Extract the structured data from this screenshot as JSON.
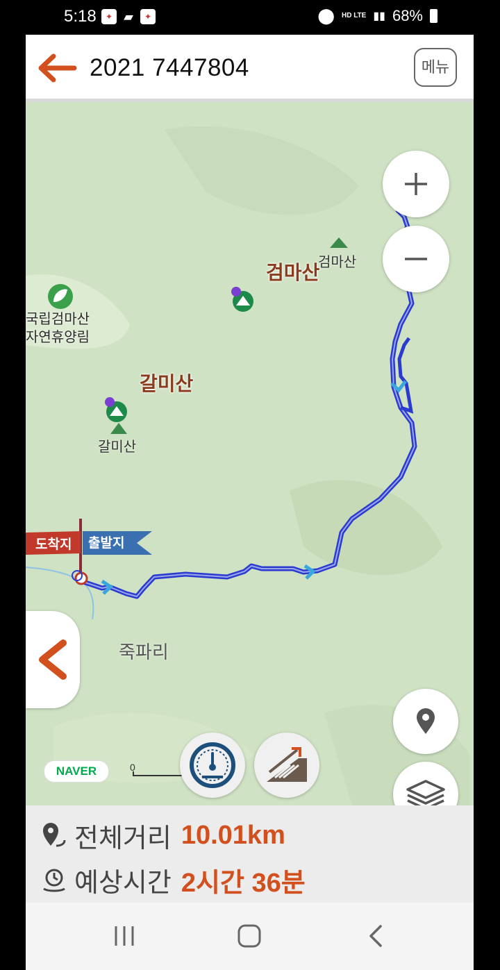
{
  "status_bar": {
    "time": "5:18",
    "network": "HD LTE",
    "battery": "68%"
  },
  "header": {
    "title": "2021 7447804",
    "menu_label": "메뉴"
  },
  "map": {
    "peaks": {
      "geomasan_main": "검마산",
      "geomasan_small": "검마산",
      "galmisan_main": "갈미산",
      "galmisan_small": "갈미산"
    },
    "forest_line1": "국립검마산",
    "forest_line2": "자연휴양림",
    "village": "죽파리",
    "flag_end": "도착지",
    "flag_start": "출발지",
    "naver_logo": "NAVER",
    "scale_zero": "0"
  },
  "summary": {
    "distance_label": "전체거리",
    "distance_value": "10.01km",
    "time_label": "예상시간",
    "time_value": "2시간 36분"
  },
  "colors": {
    "accent": "#d2501d",
    "track": "#2b3bd1",
    "map_bg": "#cfe2c3",
    "flag_red": "#c0392b",
    "flag_blue": "#3a6fb0"
  }
}
